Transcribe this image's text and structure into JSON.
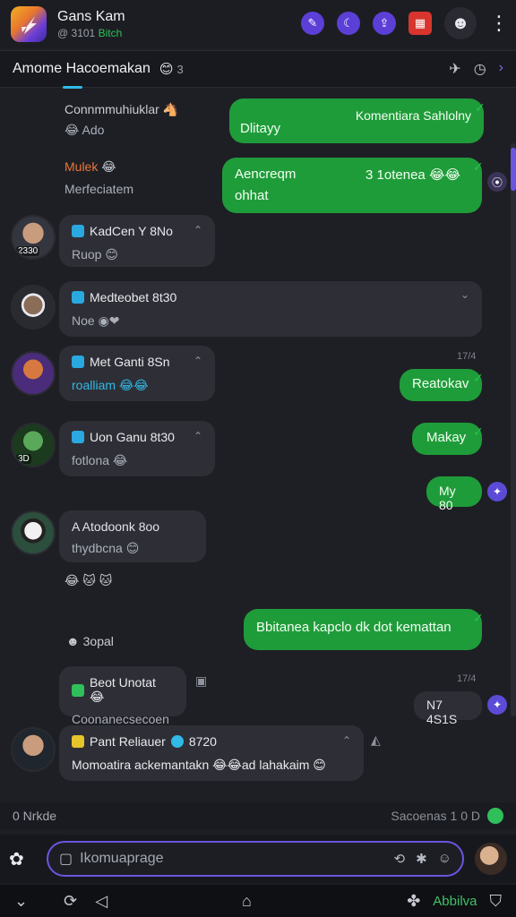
{
  "app": {
    "title": "Gans Kam",
    "subtitle_prefix": "@ 3101",
    "subtitle_accent": "Bitch"
  },
  "channel": {
    "name": "Amome Hacoemakan",
    "emoji": "😊",
    "count": "3"
  },
  "messages": {
    "m1": {
      "name": "Connmmuhiuklar",
      "icon": "🐴",
      "body": "😂 Ado"
    },
    "m2": {
      "text_left": "Dlitayy",
      "text_right": "Komentiara Sahlolny"
    },
    "m3": {
      "name": "Mulek",
      "badge": "😂",
      "body": "Merfeciatem"
    },
    "m4": {
      "line1_left": "Aencreqm",
      "line1_right": "3 1otenea 😂😂",
      "line2": "ohhat"
    },
    "m5": {
      "name": "KadCen Y 8No",
      "body": "Ruop 😊",
      "avatar_label": "2330"
    },
    "m6": {
      "name": "Medteobet 8t30",
      "body": "Noe"
    },
    "m7": {
      "name": "Met Ganti 8Sn",
      "body": "roalliam 😂😂"
    },
    "m8": {
      "text": "Reatokav"
    },
    "m9": {
      "name": "Uon Ganu 8t30",
      "body": "fotlona 😂",
      "avatar_label": "3D"
    },
    "m10": {
      "text": "Makay"
    },
    "m11": {
      "text": "My 80"
    },
    "m12": {
      "name": "A Atodoonk 8oo",
      "body": "thydbcna 😊"
    },
    "m13": {
      "text": "Bbitanea kapclo dk dot kemattan"
    },
    "m14": {
      "text": "3opal"
    },
    "m15": {
      "name": "Beot Unotat 😂",
      "body": "Coonanecsecoen"
    },
    "m16": {
      "text": "N7 4S1S"
    },
    "m17": {
      "name": "Pant Reliauer",
      "badge_num": "8720",
      "body": "Momoatira ackemantakn 😂😂ad lahakaim 😊"
    }
  },
  "timestamps": {
    "t1": "17/4",
    "t2": "17/4"
  },
  "inline_emoji_row": "😂 🐱 🐱",
  "status": {
    "left": "0 Nrkde",
    "right": "Sacoenas 1 0 D"
  },
  "composer": {
    "placeholder": "Ikomuaprage"
  },
  "nav": {
    "active_label": "Abbilva"
  },
  "colors": {
    "accent": "#6a55e0",
    "outgoing": "#1f9c3a",
    "incoming": "#2e2f36",
    "background": "#1e1f24"
  }
}
